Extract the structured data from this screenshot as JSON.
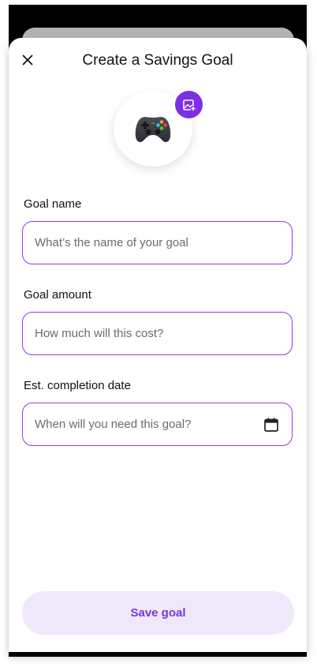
{
  "header": {
    "title": "Create a Savings Goal",
    "close_icon": "close-icon"
  },
  "goal_image": {
    "icon": "game-controller-icon",
    "edit_icon": "add-photo-icon",
    "accent_color": "#7c2ee6"
  },
  "form": {
    "goal_name": {
      "label": "Goal name",
      "placeholder": "What’s the name of your goal",
      "value": ""
    },
    "goal_amount": {
      "label": "Goal amount",
      "placeholder": "How much will this cost?",
      "value": ""
    },
    "completion_date": {
      "label": "Est. completion date",
      "placeholder": "When will you need this goal?",
      "value": "",
      "icon": "calendar-icon"
    }
  },
  "footer": {
    "save_label": "Save goal",
    "button_bg": "#efe8fa",
    "button_text_color": "#7a35d8"
  }
}
